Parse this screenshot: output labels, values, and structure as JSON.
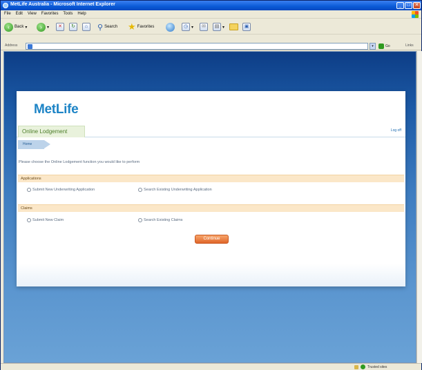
{
  "window": {
    "title": "MetLife Australia - Microsoft Internet Explorer",
    "buttons": {
      "minimize": "_",
      "maximize": "□",
      "close": "✕"
    }
  },
  "menu": [
    "File",
    "Edit",
    "View",
    "Favorites",
    "Tools",
    "Help"
  ],
  "toolbar": {
    "back_label": "Back",
    "forward_glyph": "›",
    "back_glyph": "‹",
    "stop_glyph": "✕",
    "search_label": "Search",
    "favorites_label": "Favorites"
  },
  "addressbar": {
    "label": "Address",
    "value": "",
    "go_label": "Go",
    "links_label": "Links"
  },
  "page": {
    "logo_text": "MetLife",
    "tab_label": "Online Lodgement",
    "logoff_label": "Log off",
    "breadcrumb": "Home",
    "intro": "Please choose the Online Lodgement function you would like to perform",
    "sections": [
      {
        "heading": "Applications",
        "options": [
          "Submit New Underwriting Application",
          "Search Existing Underwriting Application"
        ]
      },
      {
        "heading": "Claims",
        "options": [
          "Submit New Claim",
          "Search Existing Claims"
        ]
      }
    ],
    "continue_label": "Continue"
  },
  "statusbar": {
    "zone_label": "Trusted sites"
  },
  "colors": {
    "brand_blue": "#1d84c6",
    "tab_green": "#4d7e2a",
    "section_bg": "#fbe7c8",
    "button_orange": "#e0662a"
  }
}
